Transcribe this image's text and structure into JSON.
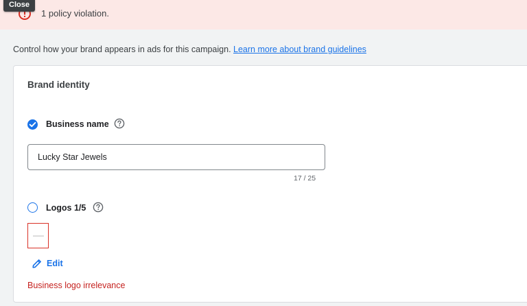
{
  "banner": {
    "message": "1 policy violation.",
    "background": "#fce8e6",
    "icon": "error-icon"
  },
  "tooltip": {
    "label": "Close"
  },
  "description": {
    "text": "Control how your brand appears in ads for this campaign.",
    "link_label": "Learn more about brand guidelines"
  },
  "card": {
    "title": "Brand identity",
    "business_name": {
      "label": "Business name",
      "checked": true,
      "value": "Lucky Star Jewels",
      "counter": "17 / 25",
      "help_icon": "help-circle-icon"
    },
    "logos": {
      "label": "Logos 1/5",
      "checked": false,
      "help_icon": "help-circle-icon",
      "edit_label": "Edit",
      "edit_icon": "pencil-icon",
      "error": "Business logo irrelevance"
    }
  },
  "colors": {
    "accent": "#1a73e8",
    "error": "#d93025",
    "error_text": "#c5221f"
  }
}
